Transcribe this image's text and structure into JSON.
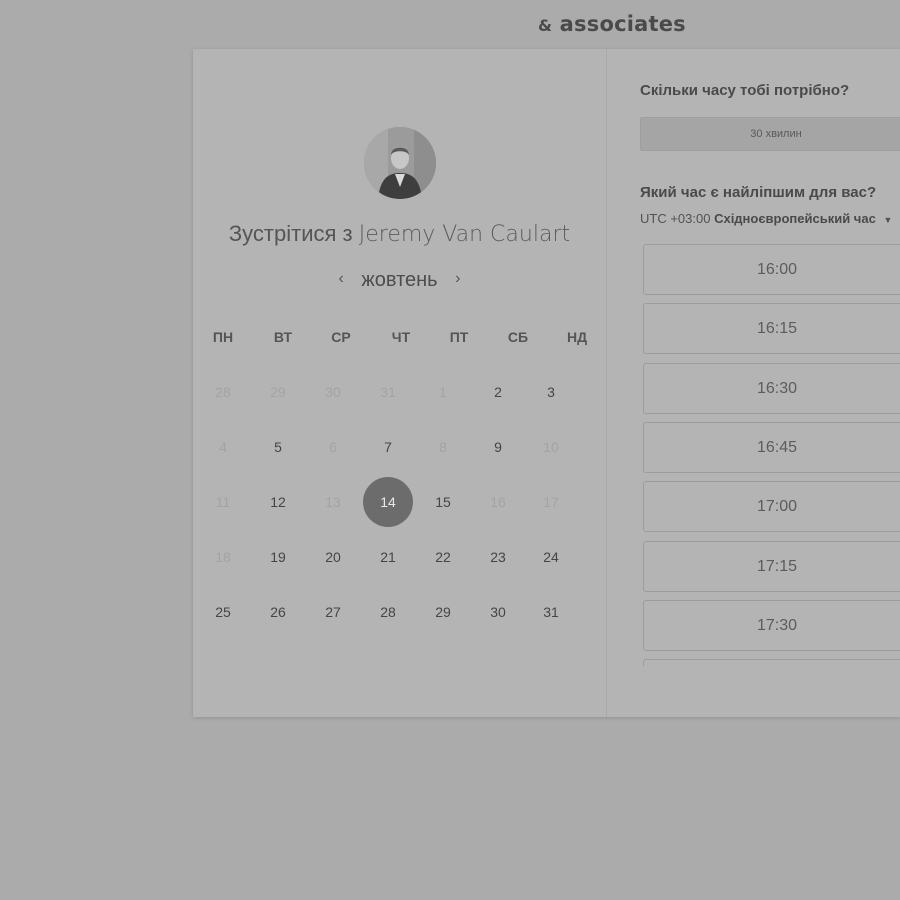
{
  "brand": {
    "amp": "&",
    "text": "associates"
  },
  "calendar": {
    "title_prefix": "Зустрітися з",
    "host_name": "Jeremy Van Caulart",
    "month": "жовтень",
    "prev_symbol": "‹",
    "next_symbol": "›",
    "weekdays": [
      "ПН",
      "ВТ",
      "СР",
      "ЧТ",
      "ПТ",
      "СБ",
      "НД"
    ],
    "weeks": [
      [
        {
          "d": "28",
          "s": "dim"
        },
        {
          "d": "29",
          "s": "dim"
        },
        {
          "d": "30",
          "s": "dim"
        },
        {
          "d": "31",
          "s": "dim"
        },
        {
          "d": "1",
          "s": "dim"
        },
        {
          "d": "2",
          "s": "avail"
        },
        {
          "d": "3",
          "s": "avail"
        }
      ],
      [
        {
          "d": "4",
          "s": "dim"
        },
        {
          "d": "5",
          "s": "avail"
        },
        {
          "d": "6",
          "s": "dim"
        },
        {
          "d": "7",
          "s": "avail"
        },
        {
          "d": "8",
          "s": "dim"
        },
        {
          "d": "9",
          "s": "avail"
        },
        {
          "d": "10",
          "s": "dim"
        }
      ],
      [
        {
          "d": "11",
          "s": "dim"
        },
        {
          "d": "12",
          "s": "avail"
        },
        {
          "d": "13",
          "s": "dim"
        },
        {
          "d": "14",
          "s": "selected"
        },
        {
          "d": "15",
          "s": "avail"
        },
        {
          "d": "16",
          "s": "dim"
        },
        {
          "d": "17",
          "s": "dim"
        }
      ],
      [
        {
          "d": "18",
          "s": "dim"
        },
        {
          "d": "19",
          "s": "avail"
        },
        {
          "d": "20",
          "s": "avail"
        },
        {
          "d": "21",
          "s": "avail"
        },
        {
          "d": "22",
          "s": "avail"
        },
        {
          "d": "23",
          "s": "avail"
        },
        {
          "d": "24",
          "s": "avail"
        }
      ],
      [
        {
          "d": "25",
          "s": "avail"
        },
        {
          "d": "26",
          "s": "avail"
        },
        {
          "d": "27",
          "s": "avail"
        },
        {
          "d": "28",
          "s": "avail"
        },
        {
          "d": "29",
          "s": "avail"
        },
        {
          "d": "30",
          "s": "avail"
        },
        {
          "d": "31",
          "s": "avail"
        }
      ]
    ]
  },
  "booking": {
    "duration_question": "Скільки часу тобі потрібно?",
    "duration_value": "30 хвилин",
    "time_question": "Який час є найліпшим для вас?",
    "timezone_offset": "UTC +03:00",
    "timezone_name": "Східноєвропейський час",
    "timezone_caret_icon": "caret-down-icon",
    "slots": [
      "16:00",
      "16:15",
      "16:30",
      "16:45",
      "17:00",
      "17:15",
      "17:30",
      ""
    ]
  },
  "colors": {
    "background": "#ababab",
    "card": "#b4b4b4",
    "selected_day": "#6c6c6c"
  }
}
